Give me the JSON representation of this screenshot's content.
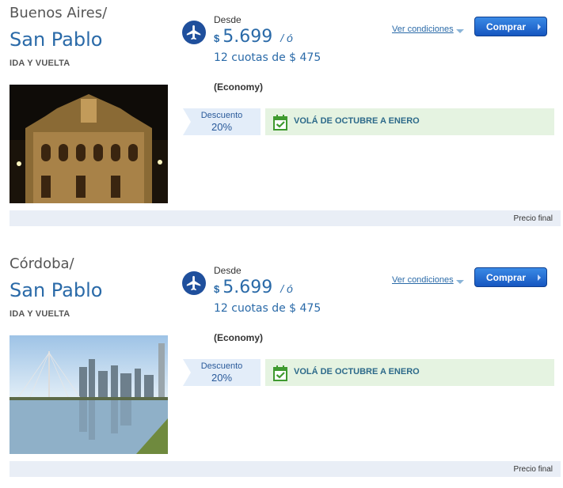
{
  "offers": [
    {
      "origin": "Buenos Aires/",
      "destination": "San Pablo",
      "trip_type": "IDA Y VUELTA",
      "from_label": "Desde",
      "currency": "$",
      "price": "5.699",
      "or_label": "/ ó",
      "installments": "12 cuotas de $ 475",
      "cabin": "(Economy)",
      "conditions_label": "Ver condiciones",
      "buy_label": "Comprar",
      "discount_label": "Descuento",
      "discount_value": "20%",
      "promo_text": "VOLÁ DE OCTUBRE A ENERO",
      "footer_label": "Precio final"
    },
    {
      "origin": "Córdoba/",
      "destination": "San Pablo",
      "trip_type": "IDA Y VUELTA",
      "from_label": "Desde",
      "currency": "$",
      "price": "5.699",
      "or_label": "/ ó",
      "installments": "12 cuotas de $ 475",
      "cabin": "(Economy)",
      "conditions_label": "Ver condiciones",
      "buy_label": "Comprar",
      "discount_label": "Descuento",
      "discount_value": "20%",
      "promo_text": "VOLÁ DE OCTUBRE A ENERO",
      "footer_label": "Precio final"
    }
  ],
  "icons": {
    "plane": "airplane-icon",
    "calendar": "calendar-check-icon"
  },
  "colors": {
    "accent": "#2a6aa8",
    "plane_circle": "#1f4f9c",
    "buy_button": "#1656c0",
    "discount_bg": "#e3edf9",
    "promo_bg": "#e5f3e1",
    "footer_bg": "#e9eef6"
  }
}
